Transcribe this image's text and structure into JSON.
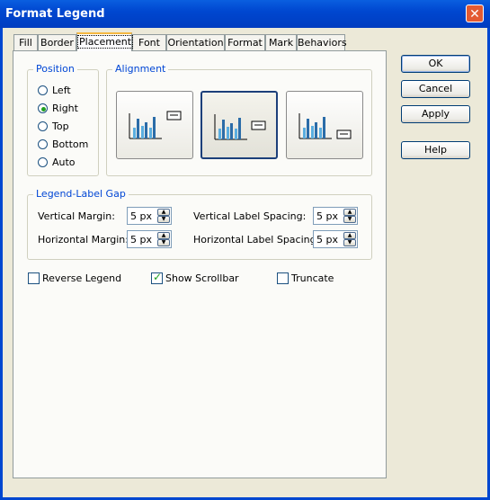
{
  "window": {
    "title": "Format Legend",
    "close_label": "✕"
  },
  "tabs": [
    {
      "label": "Fill"
    },
    {
      "label": "Border"
    },
    {
      "label": "Placement"
    },
    {
      "label": "Font"
    },
    {
      "label": "Orientation"
    },
    {
      "label": "Format"
    },
    {
      "label": "Mark"
    },
    {
      "label": "Behaviors"
    }
  ],
  "active_tab": "Placement",
  "position": {
    "title": "Position",
    "options": [
      {
        "label": "Left"
      },
      {
        "label": "Right"
      },
      {
        "label": "Top"
      },
      {
        "label": "Bottom"
      },
      {
        "label": "Auto"
      }
    ],
    "selected": "Right"
  },
  "alignment": {
    "title": "Alignment",
    "options": [
      "top",
      "middle",
      "bottom"
    ],
    "selected": "middle"
  },
  "gap": {
    "title": "Legend-Label Gap",
    "vertical_margin_label": "Vertical Margin:",
    "vertical_margin_value": "5 px",
    "horizontal_margin_label": "Horizontal Margin:",
    "horizontal_margin_value": "5 px",
    "vertical_spacing_label": "Vertical Label Spacing:",
    "vertical_spacing_value": "5 px",
    "horizontal_spacing_label": "Horizontal Label Spacing:",
    "horizontal_spacing_value": "5 px"
  },
  "checks": {
    "reverse_label": "Reverse Legend",
    "reverse_checked": false,
    "scrollbar_label": "Show Scrollbar",
    "scrollbar_checked": true,
    "truncate_label": "Truncate",
    "truncate_checked": false
  },
  "buttons": {
    "ok": "OK",
    "cancel": "Cancel",
    "apply": "Apply",
    "help": "Help"
  },
  "colors": {
    "titlebar": "#0047d0",
    "group_title": "#0046d5",
    "accent_bar": "#4aa6d8"
  }
}
